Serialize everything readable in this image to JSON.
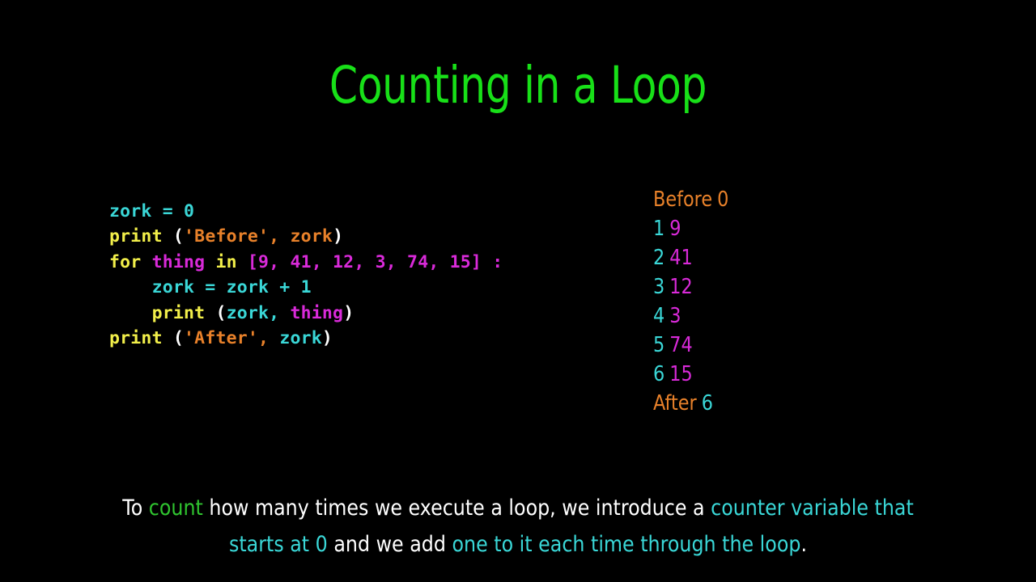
{
  "slide": {
    "title": "Counting in a Loop",
    "background_color": "#000000",
    "title_color": "#18e018"
  },
  "palette": {
    "cyan": "#3ad7d7",
    "yellow": "#f2ef4a",
    "orange": "#e8812a",
    "magenta": "#d92ad9",
    "white": "#ffffff",
    "green": "#2fc42f"
  },
  "code": {
    "language": "python",
    "lines": [
      {
        "id": "code-line-1",
        "plain": "zork = 0",
        "tokens": [
          {
            "text": "zork = 0",
            "color": "cyan"
          }
        ]
      },
      {
        "id": "code-line-2",
        "plain": "print ('Before', zork)",
        "tokens": [
          {
            "text": "print ",
            "color": "yellow"
          },
          {
            "text": "(",
            "color": "white"
          },
          {
            "text": "'Before', zork",
            "color": "orange"
          },
          {
            "text": ")",
            "color": "white"
          }
        ]
      },
      {
        "id": "code-line-3",
        "plain": "for thing in [9, 41, 12, 3, 74, 15] :",
        "tokens": [
          {
            "text": "for ",
            "color": "yellow"
          },
          {
            "text": "thing ",
            "color": "magenta"
          },
          {
            "text": "in ",
            "color": "yellow"
          },
          {
            "text": "[9, 41, 12, 3, 74, 15] :",
            "color": "magenta"
          }
        ]
      },
      {
        "id": "code-line-4",
        "plain": "    zork = zork + 1",
        "tokens": [
          {
            "text": "    zork = zork + 1",
            "color": "cyan"
          }
        ]
      },
      {
        "id": "code-line-5",
        "plain": "    print (zork, thing)",
        "tokens": [
          {
            "text": "    print ",
            "color": "yellow"
          },
          {
            "text": "(",
            "color": "white"
          },
          {
            "text": "zork, ",
            "color": "cyan"
          },
          {
            "text": "thing",
            "color": "magenta"
          },
          {
            "text": ")",
            "color": "white"
          }
        ]
      },
      {
        "id": "code-line-6",
        "plain": "print ('After', zork)",
        "tokens": [
          {
            "text": "print ",
            "color": "yellow"
          },
          {
            "text": "(",
            "color": "white"
          },
          {
            "text": "'After', ",
            "color": "orange"
          },
          {
            "text": "zork",
            "color": "cyan"
          },
          {
            "text": ")",
            "color": "white"
          }
        ]
      }
    ]
  },
  "output": {
    "lines": [
      {
        "id": "output-line-before",
        "label": "Before",
        "label_color": "orange",
        "value": "0",
        "value_color": "orange"
      },
      {
        "id": "output-line-1",
        "label": "1",
        "label_color": "cyan",
        "value": "9",
        "value_color": "magenta"
      },
      {
        "id": "output-line-2",
        "label": "2",
        "label_color": "cyan",
        "value": "41",
        "value_color": "magenta"
      },
      {
        "id": "output-line-3",
        "label": "3",
        "label_color": "cyan",
        "value": "12",
        "value_color": "magenta"
      },
      {
        "id": "output-line-4",
        "label": "4",
        "label_color": "cyan",
        "value": "3",
        "value_color": "magenta"
      },
      {
        "id": "output-line-5",
        "label": "5",
        "label_color": "cyan",
        "value": "74",
        "value_color": "magenta"
      },
      {
        "id": "output-line-6",
        "label": "6",
        "label_color": "cyan",
        "value": "15",
        "value_color": "magenta"
      },
      {
        "id": "output-line-after",
        "label": "After",
        "label_color": "orange",
        "value": "6",
        "value_color": "cyan"
      }
    ]
  },
  "caption": {
    "segments": [
      {
        "text": "To ",
        "color": "white"
      },
      {
        "text": "count",
        "color": "green"
      },
      {
        "text": " how many times we execute a loop, we introduce a ",
        "color": "white"
      },
      {
        "text": "counter variable that starts at 0",
        "color": "cyan"
      },
      {
        "text": " and we add ",
        "color": "white"
      },
      {
        "text": "one to it each time through the loop",
        "color": "cyan"
      },
      {
        "text": ".",
        "color": "white"
      }
    ],
    "full_text": "To count how many times we execute a loop, we introduce a counter variable that starts at 0 and we add one to it each time through the loop."
  }
}
